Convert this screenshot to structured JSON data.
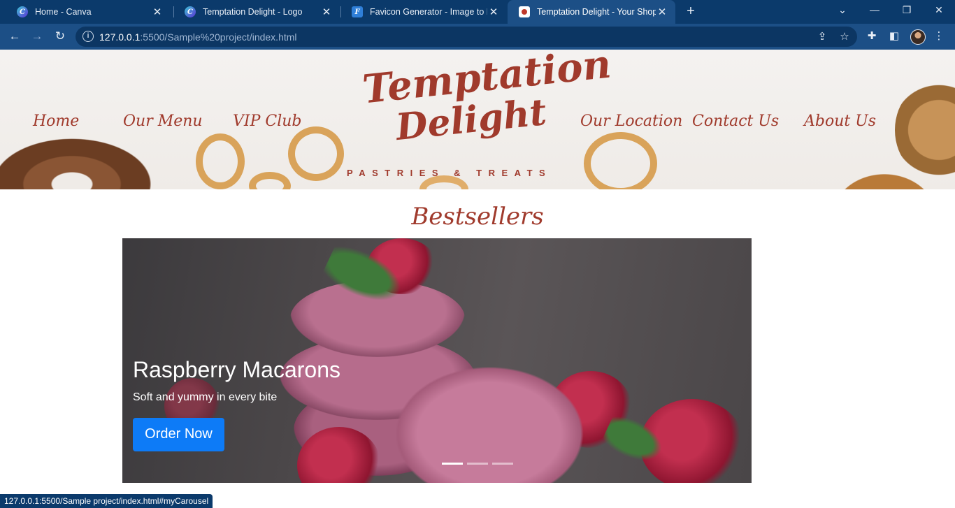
{
  "browser": {
    "tabs": [
      {
        "title": "Home - Canva",
        "favicon": "canva-icon"
      },
      {
        "title": "Temptation Delight - Logo",
        "favicon": "canva-icon"
      },
      {
        "title": "Favicon Generator - Image to Fav",
        "favicon": "favicon-generator-icon"
      },
      {
        "title": "Temptation Delight - Your Shop f",
        "favicon": "temptation-delight-icon"
      }
    ],
    "active_tab_index": 3,
    "url_host": "127.0.0.1",
    "url_path": ":5500/Sample%20project/index.html",
    "status_url": "127.0.0.1:5500/Sample project/index.html#myCarousel"
  },
  "site": {
    "nav_left": [
      "Home",
      "Our Menu",
      "VIP Club"
    ],
    "nav_right": [
      "Our Location",
      "Contact Us",
      "About Us"
    ],
    "logo_line1": "Temptation",
    "logo_line2": "Delight",
    "logo_tagline": "PASTRIES & TREATS",
    "section_title": "Bestsellers",
    "carousel": {
      "slide_title": "Raspberry Macarons",
      "slide_text": "Soft and yummy in every bite",
      "button_label": "Order Now",
      "slide_count": 3,
      "active_slide": 0
    }
  },
  "colors": {
    "brand": "#a03a2c",
    "chrome_dark": "#0b3a6b",
    "chrome": "#1c4f86",
    "button": "#0d7bf7"
  }
}
